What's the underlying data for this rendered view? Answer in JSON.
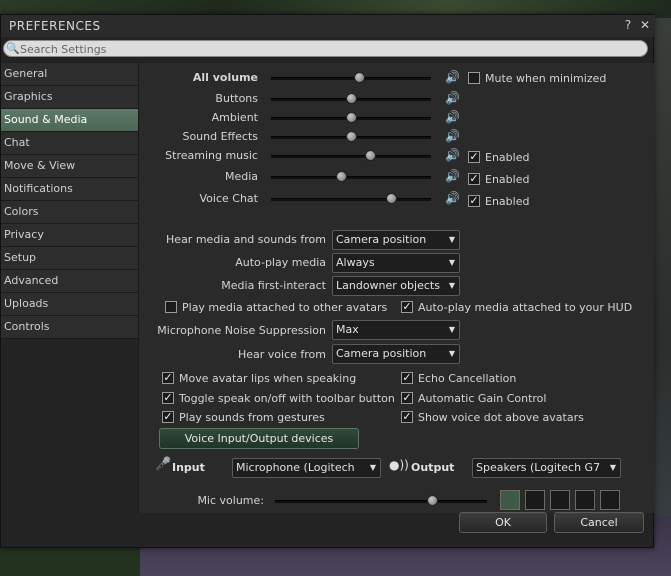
{
  "window": {
    "title": "PREFERENCES",
    "help_glyph": "?",
    "close_glyph": "✕"
  },
  "search": {
    "placeholder": "Search Settings"
  },
  "tabs": [
    {
      "label": "General"
    },
    {
      "label": "Graphics"
    },
    {
      "label": "Sound & Media",
      "active": true
    },
    {
      "label": "Chat"
    },
    {
      "label": "Move & View"
    },
    {
      "label": "Notifications"
    },
    {
      "label": "Colors"
    },
    {
      "label": "Privacy"
    },
    {
      "label": "Setup"
    },
    {
      "label": "Advanced"
    },
    {
      "label": "Uploads"
    },
    {
      "label": "Controls"
    }
  ],
  "volumes": [
    {
      "label": "All volume",
      "value": 0.55
    },
    {
      "label": "Buttons",
      "value": 0.5
    },
    {
      "label": "Ambient",
      "value": 0.5
    },
    {
      "label": "Sound Effects",
      "value": 0.5
    },
    {
      "label": "Streaming music",
      "value": 0.62
    },
    {
      "label": "Media",
      "value": 0.44
    },
    {
      "label": "Voice Chat",
      "value": 0.75
    }
  ],
  "mute_when_minimized": {
    "label": "Mute when minimized",
    "checked": false
  },
  "enabled_label": "Enabled",
  "hear_media": {
    "label": "Hear media and sounds from",
    "value": "Camera position"
  },
  "autoplay_media": {
    "label": "Auto-play media",
    "value": "Always"
  },
  "media_first_interact": {
    "label": "Media first-interact",
    "value": "Landowner objects"
  },
  "play_media_other": {
    "label": "Play media attached to other avatars",
    "checked": false
  },
  "autoplay_hud": {
    "label": "Auto-play media attached to your HUD",
    "checked": true
  },
  "noise_suppression": {
    "label": "Microphone Noise Suppression",
    "value": "Max"
  },
  "hear_voice": {
    "label": "Hear voice from",
    "value": "Camera position"
  },
  "voice_checks": [
    {
      "label": "Move avatar lips when speaking",
      "checked": true
    },
    {
      "label": "Echo Cancellation",
      "checked": true
    },
    {
      "label": "Toggle speak on/off with toolbar button",
      "checked": true
    },
    {
      "label": "Automatic Gain Control",
      "checked": true
    },
    {
      "label": "Play sounds from gestures",
      "checked": true
    },
    {
      "label": "Show voice dot above avatars",
      "checked": true
    }
  ],
  "voice_devices_button": "Voice Input/Output devices",
  "input": {
    "label": "Input",
    "value": "Microphone (Logitech"
  },
  "output": {
    "label": "Output",
    "value": "Speakers (Logitech G7"
  },
  "mic_volume": {
    "label": "Mic volume:",
    "value": 0.74,
    "level_bars": 1
  },
  "ok_button": "OK",
  "cancel_button": "Cancel"
}
